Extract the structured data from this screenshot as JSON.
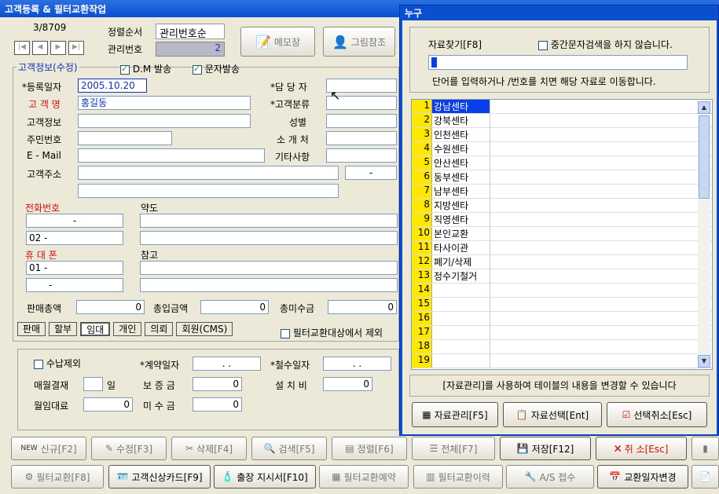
{
  "window": {
    "title": "고객등록 & 필터교환작업"
  },
  "record": {
    "counter": "3/8709",
    "sort_label": "정렬순서",
    "sort_value": "관리번호순",
    "mgmt_label": "관리번호",
    "mgmt_value": "2"
  },
  "tools": {
    "memo": "메모장",
    "picture": "그림참조"
  },
  "customer": {
    "group_label": "고객정보(수정)",
    "dm_label": "D.M 발송",
    "sms_label": "문자발송",
    "reg_date_label": "*등록일자",
    "reg_date": "2005.10.20",
    "staff_label": "*담 당 자",
    "staff": "",
    "name_label": "고 객 명",
    "name": "홍길동",
    "category_label": "*고객분류",
    "category": "",
    "info_label": "고객정보",
    "info": "",
    "gender_label": "성별",
    "gender": "",
    "ssn_label": "주민번호",
    "ssn": "",
    "referrer_label": "소 개 처",
    "referrer": "",
    "email_label": "E - Mail",
    "email": "",
    "etc_label": "기타사항",
    "etc": "",
    "addr_label": "고객주소",
    "addr1": "",
    "addr2": "",
    "zip": "-",
    "phone_label": "전화번호",
    "phone1": "-",
    "phone2": "02  -",
    "map_label": "약도",
    "mobile_label": "휴 대 폰",
    "mobile1": "01 -",
    "mobile2": "-",
    "note_label": "참고",
    "total_sales_label": "판매총액",
    "total_sales": "0",
    "total_paid_label": "총입금액",
    "total_paid": "0",
    "total_unpaid_label": "총미수금",
    "total_unpaid": "0"
  },
  "types": {
    "sale": "판매",
    "install": "할부",
    "rent": "임대",
    "personal": "개인",
    "request": "의뢰",
    "member": "회원(CMS)",
    "exclude": "필터교환대상에서 제외"
  },
  "contract": {
    "no_collect": "수납제외",
    "contract_date_label": "*계약일자",
    "contract_date": ".   .",
    "withdraw_label": "*철수일자",
    "withdraw_date": ".   .",
    "monthly_label": "매월결재",
    "day_label": "일",
    "deposit_label": "보 증 금",
    "deposit": "0",
    "install_fee_label": "설 치 비",
    "install_fee": "0",
    "rent_label": "월임대료",
    "rent": "0",
    "unpaid_label": "미 수 금",
    "unpaid": "0"
  },
  "toolbar1": {
    "new": "신규[F2]",
    "edit": "수정[F3]",
    "delete": "삭제[F4]",
    "search": "검색[F5]",
    "sort": "정렬[F6]",
    "all": "전체[F7]",
    "save": "저장[F12]",
    "cancel": "취 소[Esc]"
  },
  "toolbar2": {
    "filter": "필터교환[F8]",
    "card": "고객신상카드[F9]",
    "dispatch": "출장 지시서[F10]",
    "reserve": "필터교환예약",
    "history": "필터교환이력",
    "as": "A/S 접수",
    "date_change": "교환일자변경"
  },
  "dialog": {
    "title": "누구",
    "find_label": "자료찾기[F8]",
    "mid_search": "중간문자검색을 하지 않습니다.",
    "hint": "단어를 입력하거나  /번호를 치면 해당 자료로 이동합니다.",
    "items": [
      {
        "n": "1",
        "v": "강남센타"
      },
      {
        "n": "2",
        "v": "강북센타"
      },
      {
        "n": "3",
        "v": "인천센타"
      },
      {
        "n": "4",
        "v": "수원센타"
      },
      {
        "n": "5",
        "v": "안산센타"
      },
      {
        "n": "6",
        "v": "동부센타"
      },
      {
        "n": "7",
        "v": "남부센타"
      },
      {
        "n": "8",
        "v": "지방센타"
      },
      {
        "n": "9",
        "v": "직영센타"
      },
      {
        "n": "10",
        "v": "본인교환"
      },
      {
        "n": "11",
        "v": "타사이관"
      },
      {
        "n": "12",
        "v": "폐기/삭제"
      },
      {
        "n": "13",
        "v": "정수기철거"
      },
      {
        "n": "14",
        "v": ""
      },
      {
        "n": "15",
        "v": ""
      },
      {
        "n": "16",
        "v": ""
      },
      {
        "n": "17",
        "v": ""
      },
      {
        "n": "18",
        "v": ""
      },
      {
        "n": "19",
        "v": ""
      }
    ],
    "footer_msg": "[자료관리]를 사용하여 테이블의 내용을 변경할 수 있습니다",
    "btn_manage": "자료관리[F5]",
    "btn_select": "자료선택[Ent]",
    "btn_cancel": "선택취소[Esc]"
  }
}
